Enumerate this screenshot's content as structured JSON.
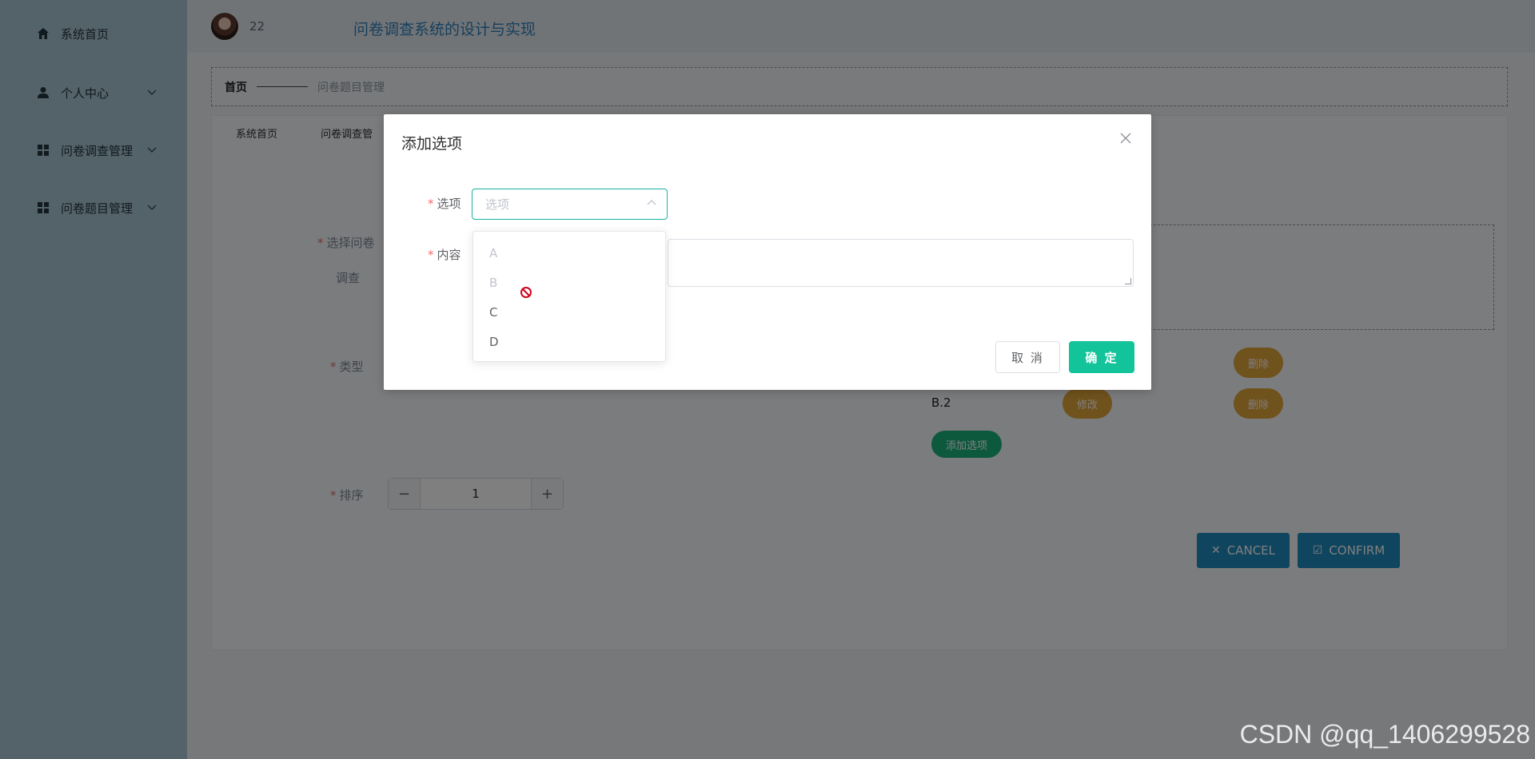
{
  "sidebar": {
    "items": [
      {
        "label": "系统首页",
        "icon": "home-icon"
      },
      {
        "label": "个人中心",
        "icon": "user-icon"
      },
      {
        "label": "问卷调查管理",
        "icon": "grid-icon"
      },
      {
        "label": "问卷题目管理",
        "icon": "grid-icon"
      }
    ]
  },
  "header": {
    "username": "22",
    "title": "问卷调查系统的设计与实现"
  },
  "breadcrumb": {
    "home": "首页",
    "current": "问卷题目管理"
  },
  "tabs": [
    "系统首页",
    "问卷调查管"
  ],
  "form": {
    "survey_label": "选择问卷",
    "survey_value": "调查",
    "type_label": "类型",
    "option_text": "B.2",
    "edit_label": "修改",
    "delete_label": "删除",
    "add_option_label": "添加选项",
    "order_label": "排序",
    "order_value": "1",
    "cancel_label": "CANCEL",
    "confirm_label": "CONFIRM"
  },
  "dialog": {
    "title": "添加选项",
    "option_label": "选项",
    "option_placeholder": "选项",
    "content_label": "内容",
    "cancel_label": "取 消",
    "confirm_label": "确 定"
  },
  "dropdown": {
    "options": [
      {
        "label": "A",
        "disabled": true
      },
      {
        "label": "B",
        "disabled": true
      },
      {
        "label": "C",
        "disabled": false
      },
      {
        "label": "D",
        "disabled": false
      }
    ]
  },
  "watermark": "CSDN @qq_1406299528",
  "colors": {
    "sidebar_bg": "#a9c4d2",
    "primary": "#13c39a",
    "orange": "#e0a43a",
    "blue": "#1f8bbd"
  }
}
